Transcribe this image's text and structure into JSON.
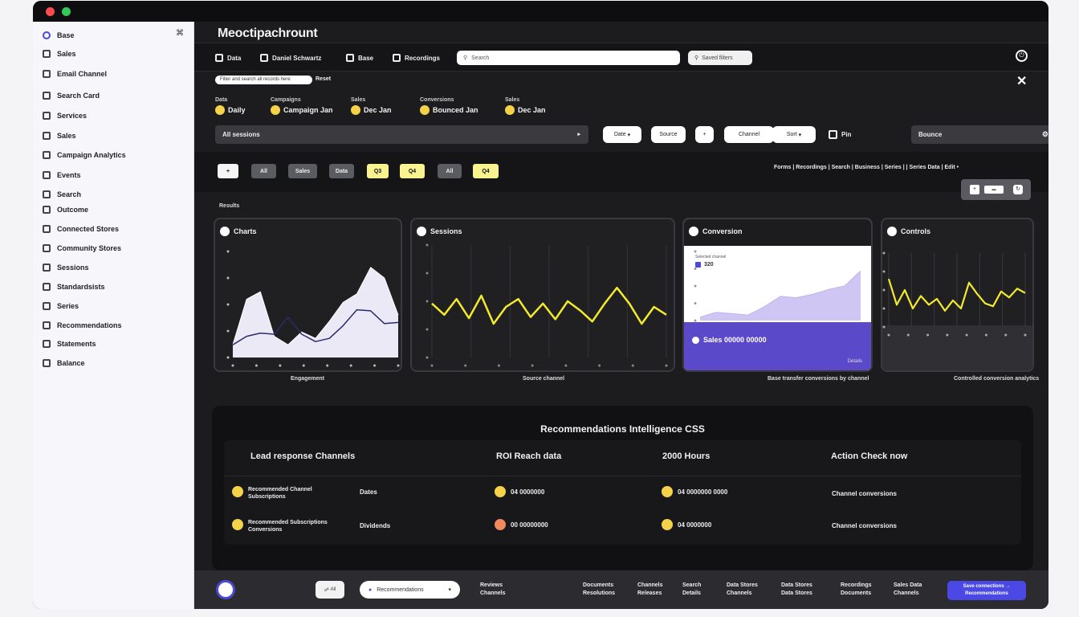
{
  "window": {
    "controls": [
      "close",
      "maximize"
    ]
  },
  "sidebar": {
    "items": [
      {
        "label": "Base",
        "icon": "circle-icon"
      },
      {
        "label": "Sales",
        "icon": "square-icon"
      },
      {
        "label": "Email Channel",
        "icon": "square-icon"
      },
      {
        "label": "Search Card",
        "icon": "square-icon"
      },
      {
        "label": "Services",
        "icon": "square-icon"
      },
      {
        "label": "Sales",
        "icon": "square-icon"
      },
      {
        "label": "Campaign Analytics",
        "icon": "square-icon"
      },
      {
        "label": "Events",
        "icon": "square-icon"
      },
      {
        "label": "Search",
        "icon": "square-icon"
      },
      {
        "label": "Outcome",
        "icon": "square-icon"
      },
      {
        "label": "Connected Stores",
        "icon": "square-icon"
      },
      {
        "label": "Community Stores",
        "icon": "square-icon"
      },
      {
        "label": "Sessions",
        "icon": "square-icon"
      },
      {
        "label": "Standardsists",
        "icon": "square-icon"
      },
      {
        "label": "Series",
        "icon": "square-icon"
      },
      {
        "label": "Recommendations",
        "icon": "square-icon"
      },
      {
        "label": "Statements",
        "icon": "square-icon"
      },
      {
        "label": "Balance",
        "icon": "square-icon"
      }
    ],
    "pin_icon": "⌘"
  },
  "header": {
    "title": "Meoctipachrount",
    "toolbar": [
      {
        "label": "Data",
        "icon": "grid-icon"
      },
      {
        "label": "Daniel Schwartz",
        "icon": "user-icon"
      },
      {
        "label": "Base",
        "icon": "doc-icon"
      },
      {
        "label": "Recordings",
        "icon": "video-icon"
      }
    ],
    "search_placeholder": "Search",
    "filter_label": "Saved filters",
    "power_icon": "⏻"
  },
  "filters": {
    "active_chip": "Filter and search all records here",
    "after_chip": "Reset",
    "close_icon": "✕",
    "stats": [
      {
        "label": "Data",
        "value": "Daily"
      },
      {
        "label": "Campaigns",
        "value": "Campaign Jan"
      },
      {
        "label": "Sales",
        "value": "Dec Jan"
      },
      {
        "label": "Conversions",
        "value": "Bounced Jan"
      },
      {
        "label": "Sales",
        "value": "Dec Jan"
      }
    ],
    "main_dropdown": "All sessions",
    "pills": [
      "Date",
      "Source",
      "+",
      "Channel",
      "Sort"
    ],
    "checkbox_label": "Pin",
    "right_dropdown": "Bounce"
  },
  "segments": [
    "+",
    "All",
    "Sales",
    "Data",
    "Q3",
    "Q4",
    "All",
    "Q4"
  ],
  "links": "Forms  |  Recordings  |  Search  |  Business  |  Series  |  |  Series Data  |  Edit  •",
  "section_label": "Results",
  "cards": [
    {
      "title": "Charts",
      "caption": "Engagement"
    },
    {
      "title": "Sessions",
      "caption": "Source channel"
    },
    {
      "title": "Conversion",
      "caption": "Base transfer conversions by channel"
    },
    {
      "title": "Controls",
      "caption": "Controlled conversion analytics"
    }
  ],
  "conversion_card": {
    "legend_line": "Selected channel",
    "legend_value": "320",
    "summary": "Sales 00000 00000",
    "footer": "Details"
  },
  "chart_data": [
    {
      "type": "area",
      "title": "Charts",
      "x": [
        0,
        1,
        2,
        3,
        4,
        5,
        6,
        7,
        8,
        9,
        10,
        11,
        12
      ],
      "series": [
        {
          "values": [
            0.12,
            0.55,
            0.62,
            0.2,
            0.12,
            0.24,
            0.18,
            0.34,
            0.52,
            0.6,
            0.85,
            0.75,
            0.4
          ]
        },
        {
          "values": [
            0.12,
            0.2,
            0.23,
            0.22,
            0.38,
            0.22,
            0.15,
            0.18,
            0.3,
            0.45,
            0.44,
            0.32,
            0.33
          ]
        }
      ]
    },
    {
      "type": "line",
      "title": "Sessions",
      "x": [
        0,
        1,
        2,
        3,
        4,
        5,
        6,
        7,
        8,
        9,
        10,
        11,
        12,
        13,
        14,
        15,
        16,
        17,
        18,
        19
      ],
      "series": [
        {
          "values": [
            0.48,
            0.38,
            0.52,
            0.35,
            0.55,
            0.3,
            0.45,
            0.52,
            0.36,
            0.48,
            0.34,
            0.5,
            0.42,
            0.32,
            0.48,
            0.62,
            0.48,
            0.3,
            0.45,
            0.38
          ]
        }
      ]
    },
    {
      "type": "area",
      "title": "Conversion",
      "x": [
        0,
        1,
        2,
        3,
        4,
        5,
        6,
        7,
        8,
        9,
        10
      ],
      "series": [
        {
          "values": [
            0.05,
            0.12,
            0.1,
            0.08,
            0.2,
            0.35,
            0.33,
            0.38,
            0.45,
            0.5,
            0.72
          ]
        }
      ]
    },
    {
      "type": "line",
      "title": "Controls",
      "x": [
        0,
        1,
        2,
        3,
        4,
        5,
        6,
        7,
        8,
        9,
        10,
        11,
        12,
        13,
        14,
        15,
        16,
        17
      ],
      "series": [
        {
          "values": [
            0.65,
            0.3,
            0.5,
            0.25,
            0.42,
            0.3,
            0.38,
            0.22,
            0.36,
            0.25,
            0.6,
            0.45,
            0.32,
            0.28,
            0.48,
            0.4,
            0.52,
            0.46
          ]
        }
      ]
    }
  ],
  "panel": {
    "title": "Recommendations Intelligence CSS",
    "columns": [
      "Lead response Channels",
      "ROI Reach data",
      "2000 Hours",
      "Action Check now"
    ],
    "rows": [
      {
        "name_line1": "Recommended Channel",
        "name_line2": "Subscriptions",
        "col2": "Dates",
        "col3": "04 0000000",
        "col4": "04 0000000 0000",
        "col5": "Channel conversions"
      },
      {
        "name_line1": "Recommended Subscriptions",
        "name_line2": "Conversions",
        "col2": "Dividends",
        "col3": "00 00000000",
        "col4": "04 0000000",
        "col5": "Channel conversions"
      }
    ]
  },
  "footer": {
    "chip": "All",
    "select_label": "Recommendations",
    "stacks": [
      {
        "l1": "Reviews",
        "l2": "Channels"
      },
      {
        "l1": "Documents",
        "l2": "Resolutions"
      },
      {
        "l1": "Channels",
        "l2": "Releases"
      },
      {
        "l1": "Search",
        "l2": "Details"
      },
      {
        "l1": "Data Stores",
        "l2": "Channels"
      },
      {
        "l1": "Data Stores",
        "l2": "Data Stores"
      },
      {
        "l1": "Recordings",
        "l2": "Documents"
      },
      {
        "l1": "Sales Data",
        "l2": "Channels"
      }
    ],
    "cta_line1": "Save connections →",
    "cta_line2": "Recommendations"
  }
}
